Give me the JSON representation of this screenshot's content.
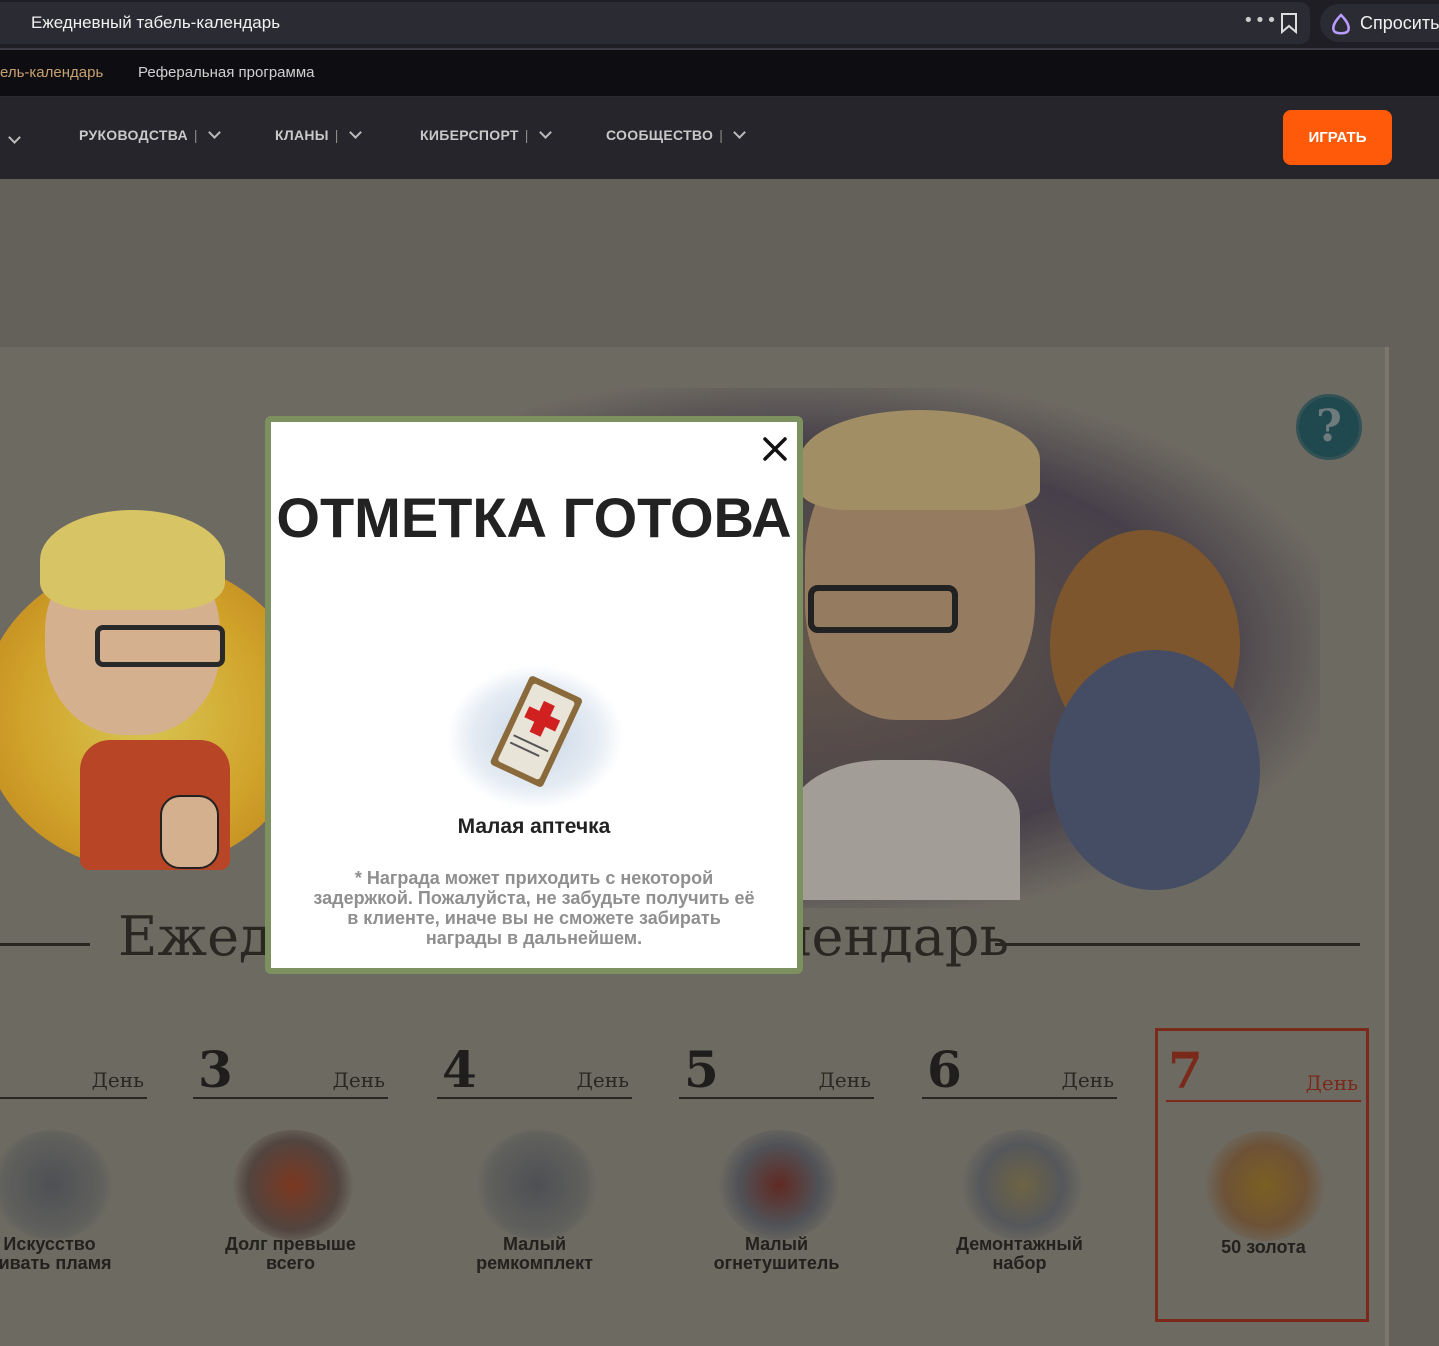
{
  "browser": {
    "tab_title": "Ежедневный табель-календарь",
    "ask_label": "Спросить"
  },
  "subnav": {
    "active_link": "ель-календарь",
    "referral_link": "Реферальная программа"
  },
  "mainnav": {
    "items": [
      "РУКОВОДСТВА",
      "КЛАНЫ",
      "КИБЕРСПОРТ",
      "СООБЩЕСТВО"
    ],
    "separator": "|",
    "play_button": "ИГРАТЬ"
  },
  "help_button": "?",
  "calendar": {
    "heading": "Ежедневный табель-календарь",
    "day_word": "День",
    "days": [
      {
        "number": "",
        "label": "Искусство\nбивать пламя"
      },
      {
        "number": "3",
        "label": "Долг превыше\nвсего"
      },
      {
        "number": "4",
        "label": "Малый\nремкомплект"
      },
      {
        "number": "5",
        "label": "Малый\nогнетушитель"
      },
      {
        "number": "6",
        "label": "Демонтажный\nнабор"
      },
      {
        "number": "7",
        "label": "50 золота"
      }
    ]
  },
  "modal": {
    "title": "ОТМЕТКА ГОТОВА",
    "reward_name": "Малая аптечка",
    "note": "* Награда может приходить с некоторой задержкой. Пожалуйста, не забудьте получить её в клиенте, иначе вы не сможете забирать награды в дальнейшем."
  },
  "colors": {
    "accent": "#ff5a0a",
    "modal_border": "#7d9160",
    "today_red": "#8a2a18"
  }
}
